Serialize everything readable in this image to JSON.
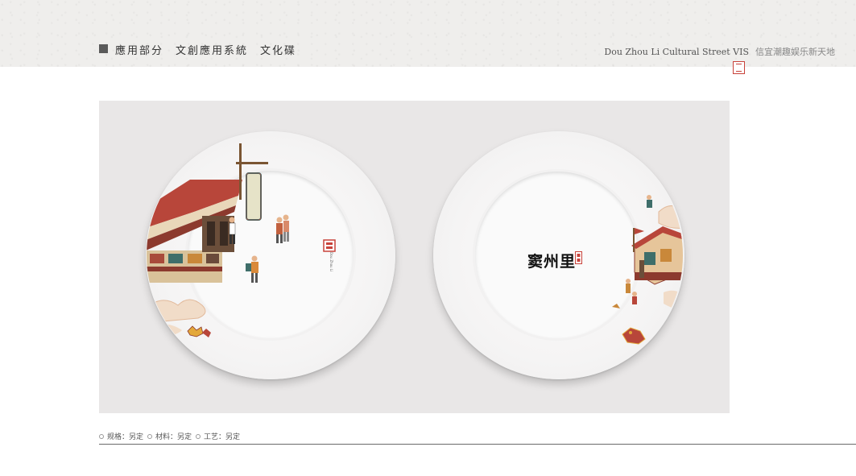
{
  "header": {
    "title": "應用部分　文創應用系統　文化碟",
    "brand_en": "Dou Zhou Li  Cultural  Street   VIS",
    "brand_cn": "信宜潮趣娱乐新天地"
  },
  "plates": {
    "right_logo_text": "窦州里",
    "left_vertical_text": "Dou Zhou Li Cultural Street"
  },
  "specs": [
    {
      "label": "规格：另定"
    },
    {
      "label": "材料：另定"
    },
    {
      "label": "工艺：另定"
    }
  ],
  "colors": {
    "seal_red": "#c8423a",
    "panel_bg": "#e9e7e7",
    "header_bg": "#efeeec"
  }
}
